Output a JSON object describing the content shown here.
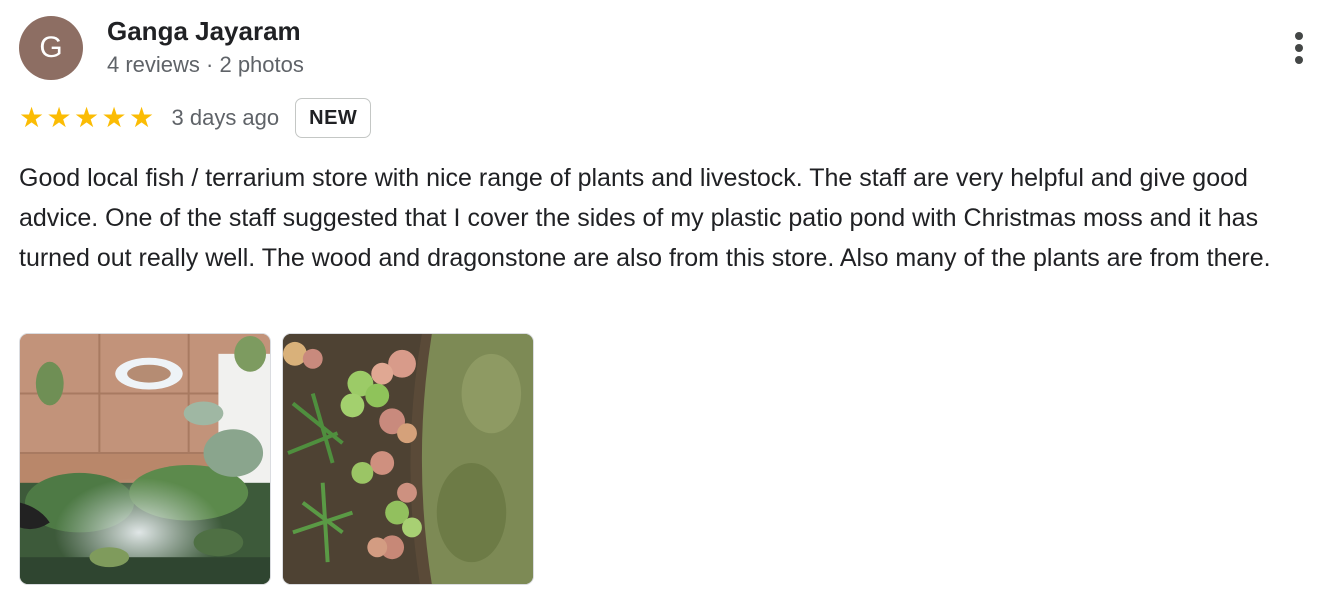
{
  "reviewer": {
    "initial": "G",
    "name": "Ganga Jayaram",
    "meta": "4 reviews · 2 photos",
    "avatar_color": "#8d6e63"
  },
  "rating": {
    "stars": 5,
    "max_stars": 5,
    "star_glyph": "★",
    "star_color": "#fbbc04",
    "date": "3 days ago",
    "badge": "NEW"
  },
  "review_text": "Good local fish / terrarium store with nice range of plants and livestock. The staff are very helpful and give good advice. One of the staff suggested that I cover the sides of my plastic patio pond with Christmas moss and it has turned out really well. The wood and dragonstone are also from this store. Also many of the plants are from there.",
  "photos": [
    {
      "subject": "terrarium-with-mister-and-ring-light"
    },
    {
      "subject": "patio-pond-with-floating-plants-and-moss"
    }
  ],
  "icons": {
    "more": "more-vert-icon"
  }
}
